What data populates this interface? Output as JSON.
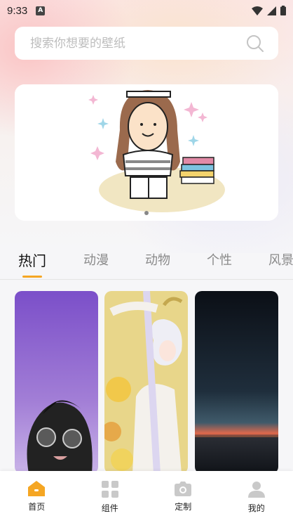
{
  "status_bar": {
    "time": "9:33",
    "app_badge": "A"
  },
  "search": {
    "placeholder": "搜索你想要的壁纸",
    "value": ""
  },
  "banner": {
    "page_count": 2,
    "active_page": 0
  },
  "tabs": [
    {
      "label": "热门",
      "active": true
    },
    {
      "label": "动漫",
      "active": false
    },
    {
      "label": "动物",
      "active": false
    },
    {
      "label": "个性",
      "active": false
    },
    {
      "label": "风景",
      "active": false
    }
  ],
  "wallpapers": [
    {
      "subject": "cat-with-sunglasses-purple"
    },
    {
      "subject": "anime-character-white-hair"
    },
    {
      "subject": "sunset-lake-night"
    }
  ],
  "bottom_nav": [
    {
      "label": "首页",
      "icon": "home-icon",
      "active": true
    },
    {
      "label": "组件",
      "icon": "grid-icon",
      "active": false
    },
    {
      "label": "定制",
      "icon": "camera-icon",
      "active": false
    },
    {
      "label": "我的",
      "icon": "user-icon",
      "active": false
    }
  ],
  "colors": {
    "accent": "#f5a623",
    "inactive_icon": "#c9c9c9",
    "tab_inactive": "#8a8a8a"
  }
}
